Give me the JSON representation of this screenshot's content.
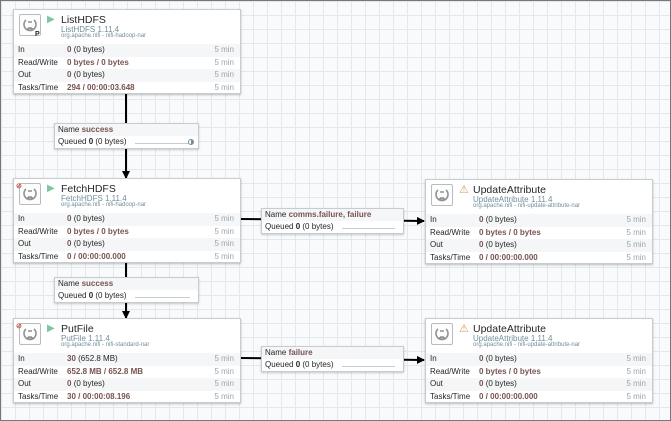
{
  "row_labels": {
    "in": "In",
    "read_write": "Read/Write",
    "out": "Out",
    "tasks_time": "Tasks/Time"
  },
  "conn_labels": {
    "name": "Name",
    "queued": "Queued"
  },
  "processors": [
    {
      "id": "listhdfs",
      "name": "ListHDFS",
      "type": "ListHDFS 1.11.4",
      "bundle": "org.apache.nifi - nifi-hadoop-nar",
      "status": "running",
      "badge": "P",
      "in": {
        "count": "0",
        "size": "(0 bytes)",
        "time": "5 min"
      },
      "read_write": {
        "value": "0 bytes / 0 bytes",
        "time": "5 min"
      },
      "out": {
        "count": "0",
        "size": "(0 bytes)",
        "time": "5 min"
      },
      "tasks_time": {
        "value": "294 / 00:00:03.648",
        "time": "5 min"
      }
    },
    {
      "id": "fetchhdfs",
      "name": "FetchHDFS",
      "type": "FetchHDFS 1.11.4",
      "bundle": "org.apache.nifi - nifi-hadoop-nar",
      "status": "running",
      "badge": "",
      "in": {
        "count": "0",
        "size": "(0 bytes)",
        "time": "5 min"
      },
      "read_write": {
        "value": "0 bytes / 0 bytes",
        "time": "5 min"
      },
      "out": {
        "count": "0",
        "size": "(0 bytes)",
        "time": "5 min"
      },
      "tasks_time": {
        "value": "0 / 00:00:00.000",
        "time": "5 min"
      }
    },
    {
      "id": "putfile",
      "name": "PutFile",
      "type": "PutFile 1.11.4",
      "bundle": "org.apache.nifi - nifi-standard-nar",
      "status": "running",
      "badge": "",
      "in": {
        "count": "30",
        "size": "(652.8 MB)",
        "time": "5 min"
      },
      "read_write": {
        "value": "652.8 MB / 652.8 MB",
        "time": "5 min"
      },
      "out": {
        "count": "0",
        "size": "(0 bytes)",
        "time": "5 min"
      },
      "tasks_time": {
        "value": "30 / 00:00:08.196",
        "time": "5 min"
      }
    },
    {
      "id": "update1",
      "name": "UpdateAttribute",
      "type": "UpdateAttribute 1.11.4",
      "bundle": "org.apache.nifi - nifi-update-attribute-nar",
      "status": "invalid",
      "badge": "",
      "in": {
        "count": "0",
        "size": "(0 bytes)",
        "time": "5 min"
      },
      "read_write": {
        "value": "0 bytes / 0 bytes",
        "time": "5 min"
      },
      "out": {
        "count": "0",
        "size": "(0 bytes)",
        "time": "5 min"
      },
      "tasks_time": {
        "value": "0 / 00:00:00.000",
        "time": "5 min"
      }
    },
    {
      "id": "update2",
      "name": "UpdateAttribute",
      "type": "UpdateAttribute 1.11.4",
      "bundle": "org.apache.nifi - nifi-update-attribute-nar",
      "status": "invalid",
      "badge": "",
      "in": {
        "count": "0",
        "size": "(0 bytes)",
        "time": "5 min"
      },
      "read_write": {
        "value": "0 bytes / 0 bytes",
        "time": "5 min"
      },
      "out": {
        "count": "0",
        "size": "(0 bytes)",
        "time": "5 min"
      },
      "tasks_time": {
        "value": "0 / 00:00:00.000",
        "time": "5 min"
      }
    }
  ],
  "connections": [
    {
      "id": "c1",
      "relationship": "success",
      "queued_count": "0",
      "queued_size": "(0 bytes)"
    },
    {
      "id": "c2",
      "relationship": "comms.failure, failure",
      "queued_count": "0",
      "queued_size": "(0 bytes)"
    },
    {
      "id": "c3",
      "relationship": "success",
      "queued_count": "0",
      "queued_size": "(0 bytes)"
    },
    {
      "id": "c4",
      "relationship": "failure",
      "queued_count": "0",
      "queued_size": "(0 bytes)"
    }
  ],
  "icons": {
    "processor": "processor-icon",
    "running": "play-icon",
    "invalid": "warning-icon",
    "disabled": "stop-badge-icon",
    "primary": "primary-node-badge",
    "backpressure": "half-circle-icon"
  },
  "colors": {
    "accent": "#775351",
    "running": "#7dc7a0",
    "warning": "#cf9f5d",
    "stopped_badge": "#ba554a",
    "muted": "#728e9b"
  }
}
